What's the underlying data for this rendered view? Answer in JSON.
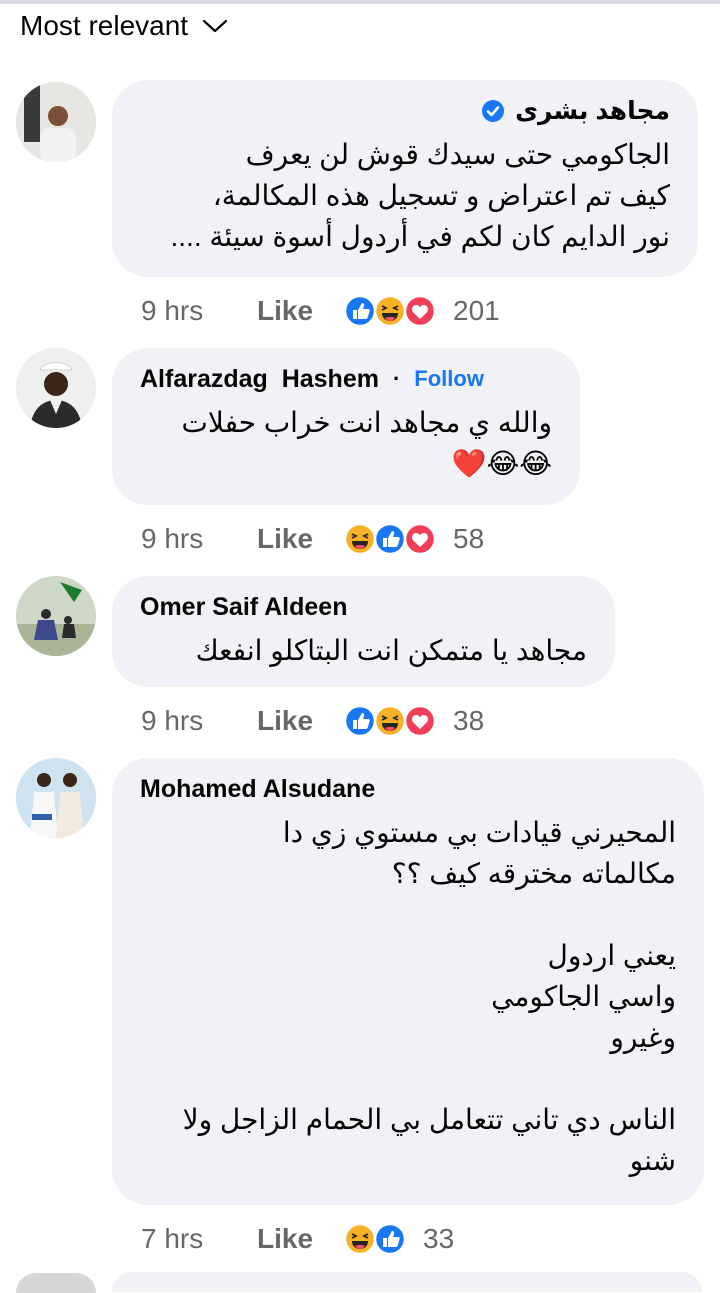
{
  "header": {
    "sort_label": "Most relevant"
  },
  "comments": [
    {
      "author": "مجاهد بشرى",
      "verified": true,
      "text": "الجاكومي حتى سيدك قوش لن يعرف\nكيف تم اعتراض و تسجيل هذه المكالمة،\nنور الدايم كان لكم في أردول أسوة سيئة ....",
      "time": "9 hrs",
      "like_label": "Like",
      "reactions": [
        "like-reaction-icon",
        "haha-reaction-icon",
        "love-reaction-icon"
      ],
      "reaction_count": "201"
    },
    {
      "author": "Alfarazdag  Hashem",
      "separator": "·",
      "follow_label": "Follow",
      "text": "والله ي مجاهد انت خراب حفلات\n😂😂❤️",
      "time": "9 hrs",
      "like_label": "Like",
      "reactions": [
        "haha-reaction-icon",
        "like-reaction-icon",
        "love-reaction-icon"
      ],
      "reaction_count": "58"
    },
    {
      "author": "Omer Saif Aldeen",
      "text": "مجاهد يا متمكن انت البتاكلو انفعك",
      "time": "9 hrs",
      "like_label": "Like",
      "reactions": [
        "like-reaction-icon",
        "haha-reaction-icon",
        "love-reaction-icon"
      ],
      "reaction_count": "38"
    },
    {
      "author": "Mohamed Alsudane",
      "text": "المحيرني قيادات بي مستوي زي دا\nمكالماته مخترقه كيف ؟؟\n\nيعني اردول\nواسي الجاكومي\nوغيرو\n\nالناس دي تاني تتعامل بي الحمام الزاجل ولا\nشنو",
      "time": "7 hrs",
      "like_label": "Like",
      "reactions": [
        "haha-reaction-icon",
        "like-reaction-icon"
      ],
      "reaction_count": "33"
    }
  ],
  "colors": {
    "bubble": "#f0f2f5",
    "accent": "#1877f2",
    "love": "#f33e58",
    "haha": "#f7b125",
    "meta_text": "#65676b"
  }
}
